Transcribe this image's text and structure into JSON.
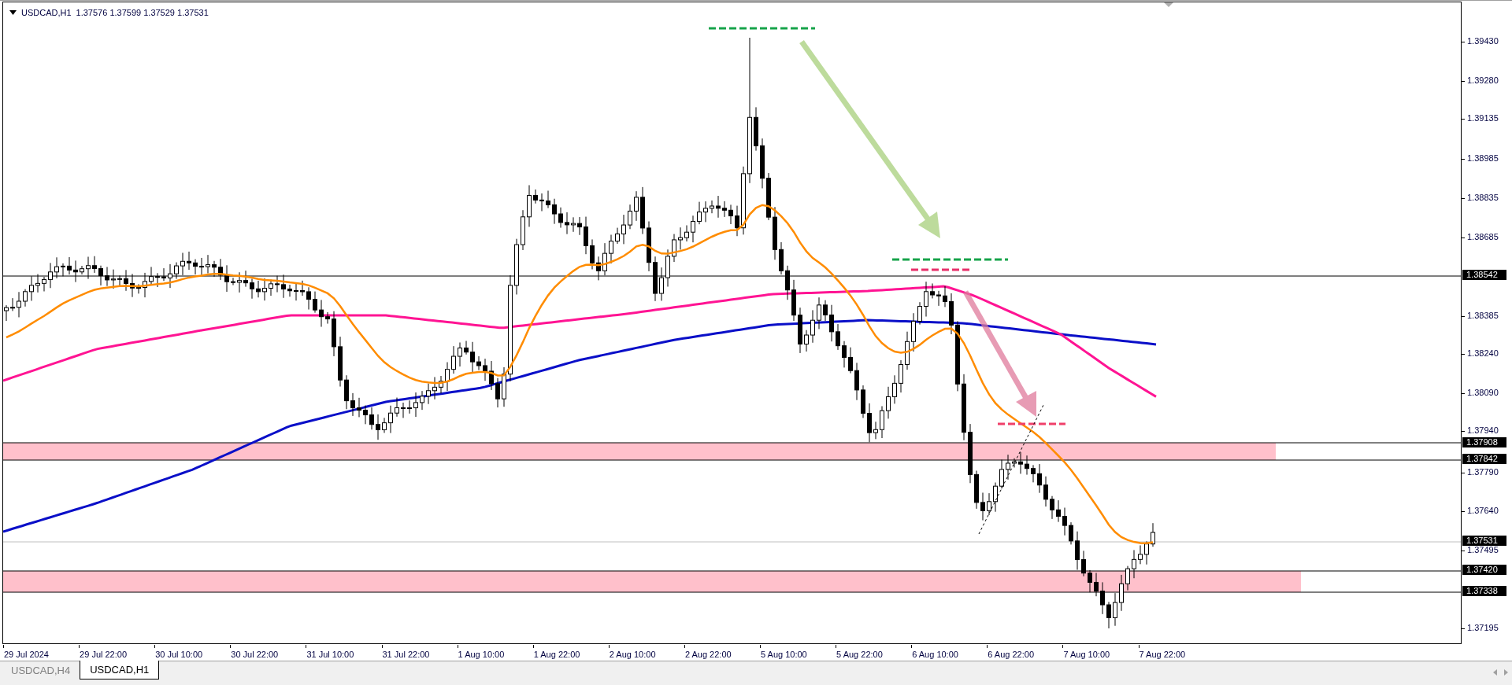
{
  "chart": {
    "symbol": "USDCAD,H1",
    "ohlc": "1.37576 1.37599 1.37529 1.37531"
  },
  "price_axis": [
    {
      "label": "1.39430",
      "kind": "tick"
    },
    {
      "label": "1.39280",
      "kind": "tick"
    },
    {
      "label": "1.39135",
      "kind": "tick"
    },
    {
      "label": "1.38985",
      "kind": "tick"
    },
    {
      "label": "1.38835",
      "kind": "tick"
    },
    {
      "label": "1.38685",
      "kind": "tick"
    },
    {
      "label": "1.38542",
      "kind": "marker"
    },
    {
      "label": "1.38385",
      "kind": "tick"
    },
    {
      "label": "1.38240",
      "kind": "tick"
    },
    {
      "label": "1.38090",
      "kind": "tick"
    },
    {
      "label": "1.37940",
      "kind": "tick"
    },
    {
      "label": "1.37908",
      "kind": "marker"
    },
    {
      "label": "1.37842",
      "kind": "marker"
    },
    {
      "label": "1.37790",
      "kind": "tick"
    },
    {
      "label": "1.37640",
      "kind": "tick"
    },
    {
      "label": "1.37531",
      "kind": "marker"
    },
    {
      "label": "1.37495",
      "kind": "tick"
    },
    {
      "label": "1.37420",
      "kind": "marker"
    },
    {
      "label": "1.37338",
      "kind": "marker"
    },
    {
      "label": "1.37195",
      "kind": "tick"
    }
  ],
  "time_axis": [
    "29 Jul 2024",
    "29 Jul 22:00",
    "30 Jul 10:00",
    "30 Jul 22:00",
    "31 Jul 10:00",
    "31 Jul 22:00",
    "1 Aug 10:00",
    "1 Aug 22:00",
    "2 Aug 10:00",
    "2 Aug 22:00",
    "5 Aug 10:00",
    "5 Aug 22:00",
    "6 Aug 10:00",
    "6 Aug 22:00",
    "7 Aug 10:00",
    "7 Aug 22:00"
  ],
  "tabs": [
    {
      "label": "USDCAD,H4",
      "selected": false
    },
    {
      "label": "USDCAD,H1",
      "selected": true
    }
  ]
}
